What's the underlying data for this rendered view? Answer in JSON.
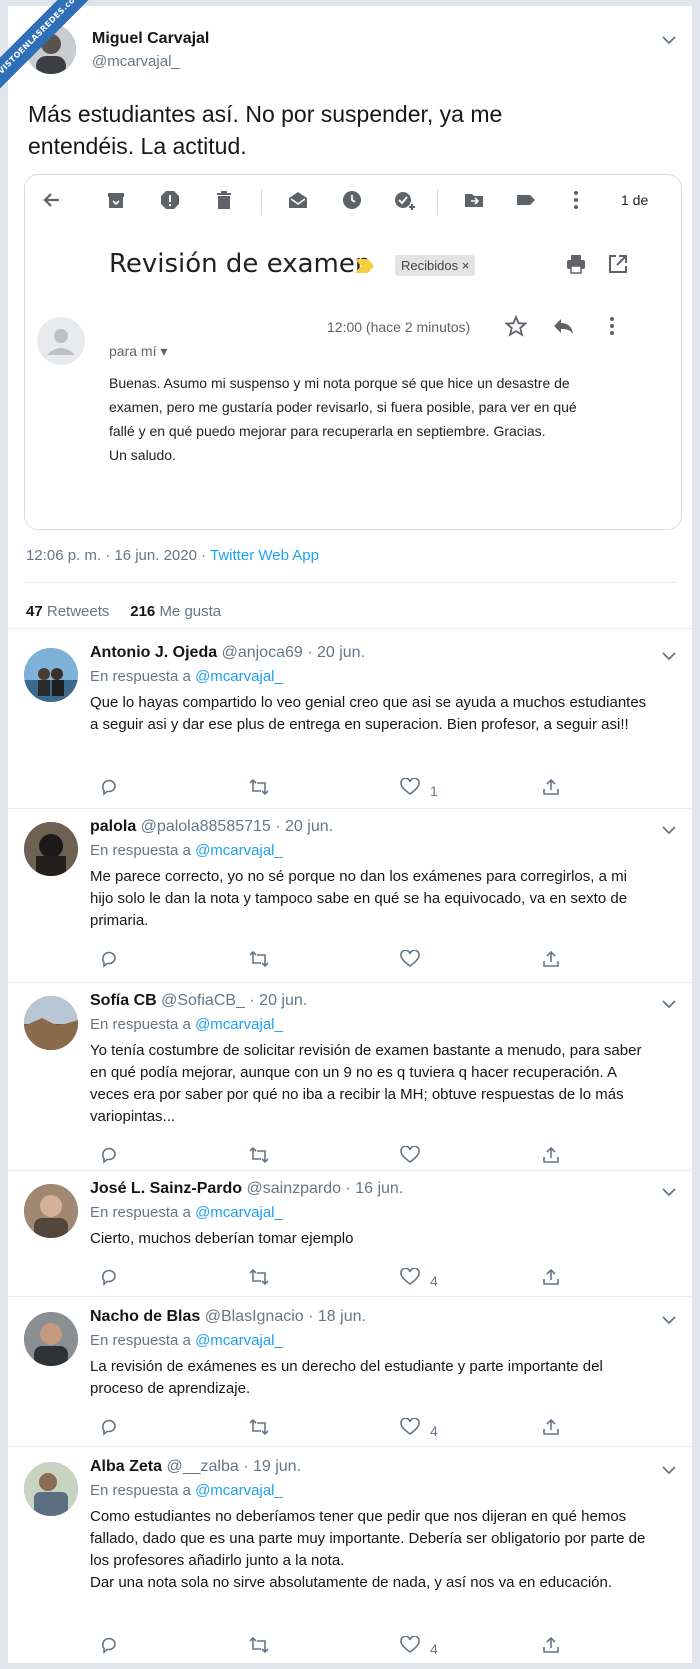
{
  "watermark": "VISTOENLASREDES.com",
  "tweet": {
    "name": "Miguel Carvajal",
    "handle": "@mcarvajal_",
    "text": "Más estudiantes así. No por suspender, ya me entendéis. La actitud.",
    "timestamp": "12:06 p. m. · 16 jun. 2020 · ",
    "source": "Twitter Web App",
    "retweets": "47",
    "retweets_label": "Retweets",
    "likes": "216",
    "likes_label": "Me gusta"
  },
  "email": {
    "pager": "1 de",
    "subject": "Revisión de examen",
    "label": "Recibidos ×",
    "time": "12:00 (hace 2 minutos)",
    "to": "para mí ▾",
    "body_lines": [
      "Buenas. Asumo mi suspenso y mi nota porque sé que hice un desastre de",
      "examen, pero me gustaría poder revisarlo, si fuera posible, para ver en qué",
      "fallé y en qué puedo mejorar para recuperarla en septiembre. Gracias.",
      "Un saludo."
    ]
  },
  "reply_prefix": "En respuesta a ",
  "reply_mention": "@mcarvajal_",
  "replies": [
    {
      "name": "Antonio J. Ojeda",
      "meta": " @anjoca69 · 20 jun.",
      "text": "Que lo hayas compartido lo veo genial creo que asi se ayuda a muchos estudiantes a seguir asi y dar ese plus de entrega en superacion. Bien profesor, a seguir asi!!",
      "likes": "1"
    },
    {
      "name": "palola",
      "meta": " @palola88585715 · 20 jun.",
      "text": "Me parece correcto, yo no sé porque no dan los exámenes para corregirlos, a mi hijo solo le dan la nota y tampoco sabe en qué se ha equivocado, va en sexto de primaria.",
      "likes": ""
    },
    {
      "name": "Sofía CB",
      "meta": " @SofiaCB_ · 20 jun.",
      "text": "Yo tenía costumbre de solicitar revisión de examen bastante a menudo, para saber en qué podía mejorar, aunque con un 9 no es q tuviera q hacer recuperación. A veces era por saber por qué no iba a recibir la MH; obtuve respuestas de lo más variopintas...",
      "likes": ""
    },
    {
      "name": "José L. Sainz-Pardo",
      "meta": " @sainzpardo · 16 jun.",
      "text": "Cierto, muchos deberían tomar ejemplo",
      "likes": "4"
    },
    {
      "name": "Nacho de Blas",
      "meta": " @BlasIgnacio · 18 jun.",
      "text": "La revisión de exámenes es un derecho del estudiante y parte importante del proceso de aprendizaje.",
      "likes": "4"
    },
    {
      "name": "Alba Zeta",
      "meta": " @__zalba · 19 jun.",
      "text": "Como estudiantes no deberíamos tener que pedir que nos dijeran en qué hemos fallado, dado que es una parte muy importante. Debería ser obligatorio por parte de los profesores añadirlo junto a la nota.\nDar una nota sola no sirve absolutamente de nada, y así nos va en educación.",
      "likes": "4"
    }
  ]
}
